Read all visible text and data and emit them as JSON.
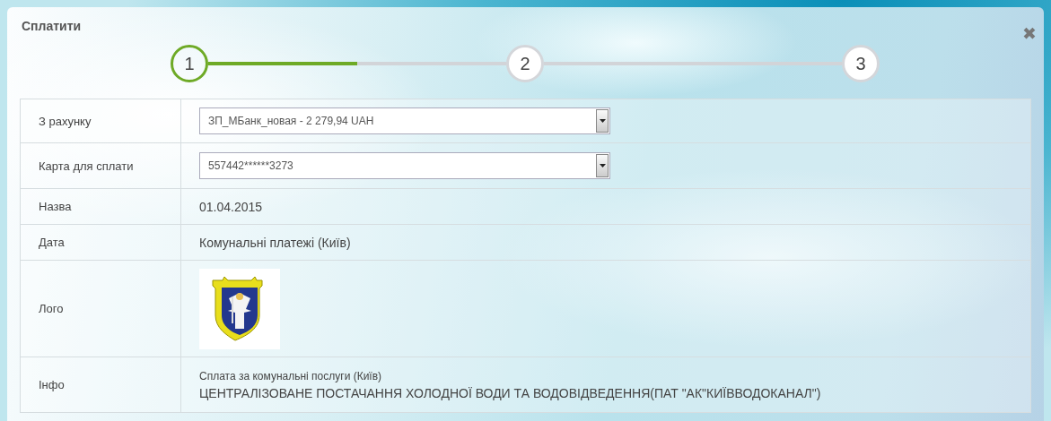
{
  "dialog": {
    "title": "Сплатити",
    "close": "✖"
  },
  "steps": [
    {
      "label": "1",
      "selected": true
    },
    {
      "label": "2",
      "selected": false
    },
    {
      "label": "3",
      "selected": false
    }
  ],
  "connectors": [
    {
      "level": 0.5
    },
    {
      "level": 0
    }
  ],
  "rows": [
    {
      "kind": "select",
      "label": "З рахунку",
      "value": "ЗП_МБанк_новая - 2 279,94 UAH"
    },
    {
      "kind": "select",
      "label": "Карта для сплати",
      "value": "557442******3273"
    },
    {
      "kind": "text",
      "label": "Назва",
      "value": "01.04.2015"
    },
    {
      "kind": "text",
      "label": "Дата",
      "value": "Комунальні платежі (Київ)"
    },
    {
      "kind": "logo",
      "label": "Лого"
    },
    {
      "kind": "info",
      "label": "Інфо",
      "lines": [
        "Сплата за комунальні послуги (Київ)",
        "ЦЕНТРАЛІЗОВАНЕ ПОСТАЧАННЯ ХОЛОДНОЇ ВОДИ ТА ВОДОВІДВЕДЕННЯ(ПАТ \"АК\"КИЇВВОДОКАНАЛ\")"
      ]
    }
  ]
}
